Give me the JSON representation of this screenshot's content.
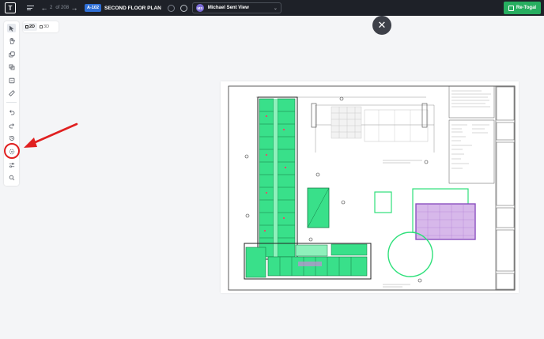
{
  "topbar": {
    "page_current": "2",
    "page_of": "of 208",
    "sheet_code": "A-102",
    "sheet_name": "SECOND FLOOR PLAN",
    "view_initials": "MS",
    "view_name": "Michael Sent View",
    "action_label": "Re-Togal"
  },
  "toolbar": {
    "tools": [
      "select-pointer-icon",
      "pan-hand-icon",
      "copy-icon",
      "layers-icon",
      "frame-icon",
      "ruler-icon",
      "undo-icon",
      "redo-icon",
      "history-icon",
      "magic-select-icon",
      "sliders-icon",
      "search-icon"
    ]
  },
  "view_toggle": {
    "twod": "2D",
    "threed": "3D"
  },
  "colors": {
    "accent_green": "#27ae60",
    "markup_green": "#2ee07a",
    "markup_purple": "#8a4fbf",
    "highlight_red": "#e02020"
  }
}
